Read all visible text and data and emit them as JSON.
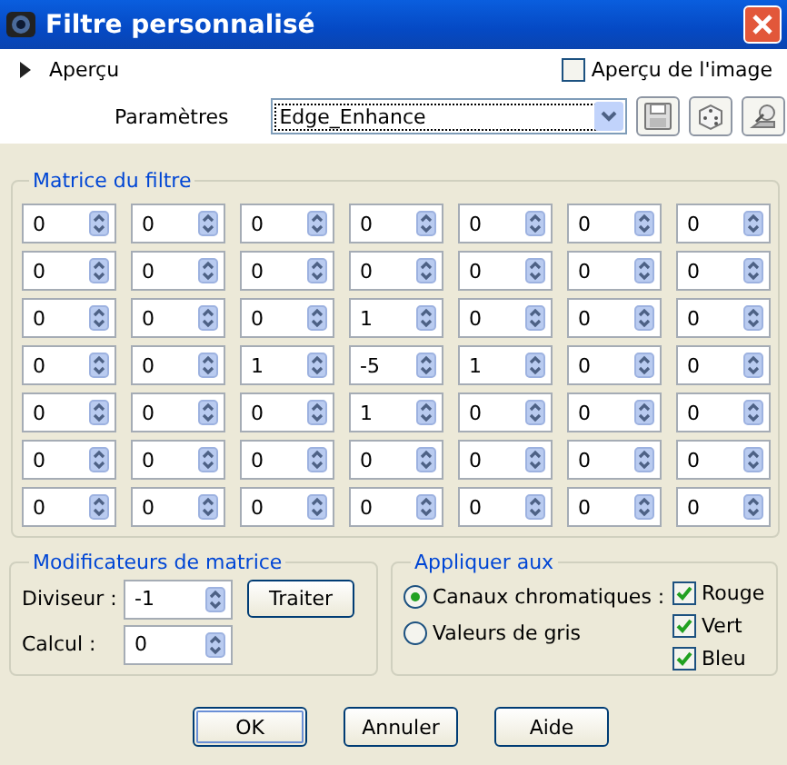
{
  "window": {
    "title": "Filtre personnalisé"
  },
  "preview": {
    "label": "Aperçu",
    "expanded": false
  },
  "image_preview": {
    "label": "Aperçu de l'image",
    "checked": false
  },
  "parameters": {
    "label": "Paramètres",
    "value": "Edge_Enhance"
  },
  "matrix": {
    "title": "Matrice du filtre",
    "rows": [
      [
        "0",
        "0",
        "0",
        "0",
        "0",
        "0",
        "0"
      ],
      [
        "0",
        "0",
        "0",
        "0",
        "0",
        "0",
        "0"
      ],
      [
        "0",
        "0",
        "0",
        "1",
        "0",
        "0",
        "0"
      ],
      [
        "0",
        "0",
        "1",
        "-5",
        "1",
        "0",
        "0"
      ],
      [
        "0",
        "0",
        "0",
        "1",
        "0",
        "0",
        "0"
      ],
      [
        "0",
        "0",
        "0",
        "0",
        "0",
        "0",
        "0"
      ],
      [
        "0",
        "0",
        "0",
        "0",
        "0",
        "0",
        "0"
      ]
    ]
  },
  "modifiers": {
    "title": "Modificateurs de matrice",
    "divisor_label": "Diviseur :",
    "divisor": "-1",
    "process_button": "Traiter",
    "bias_label": "Calcul :",
    "bias": "0"
  },
  "apply": {
    "title": "Appliquer aux",
    "modes": [
      {
        "label": "Canaux chromatiques :",
        "selected": true
      },
      {
        "label": "Valeurs de gris",
        "selected": false
      }
    ],
    "channels": [
      {
        "label": "Rouge",
        "checked": true
      },
      {
        "label": "Vert",
        "checked": true
      },
      {
        "label": "Bleu",
        "checked": true
      }
    ]
  },
  "buttons": [
    "OK",
    "Annuler",
    "Aide"
  ]
}
